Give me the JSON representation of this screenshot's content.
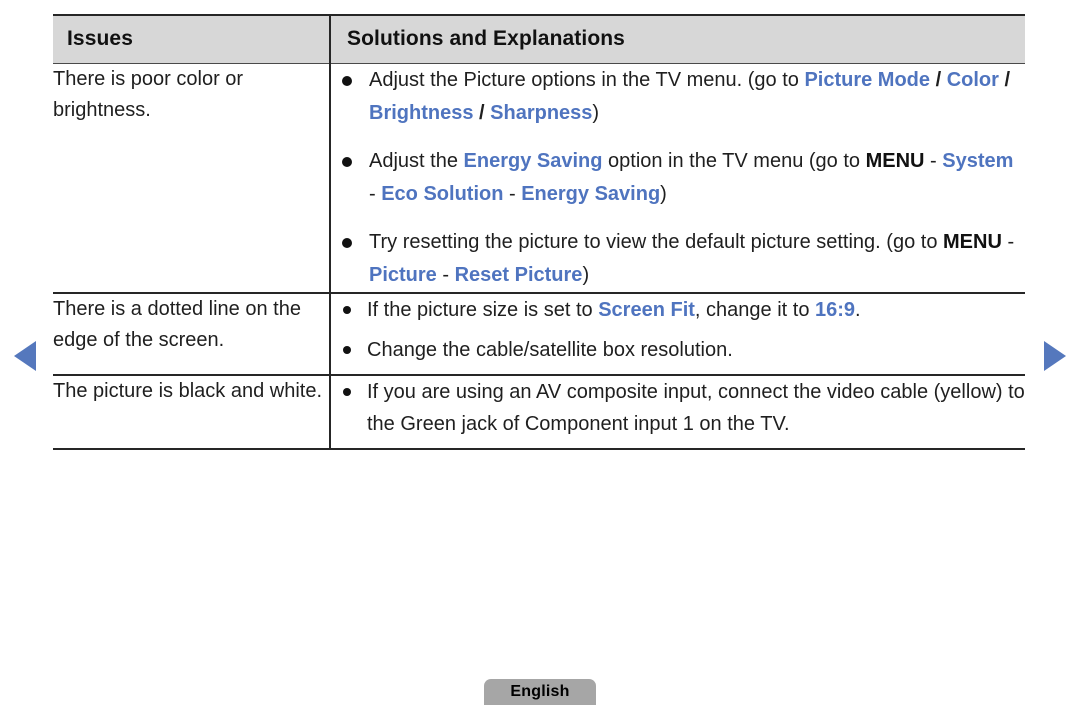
{
  "nav": {
    "prev_icon": "triangle-left-icon",
    "next_icon": "triangle-right-icon",
    "arrow_color": "#5578bd"
  },
  "table": {
    "headers": {
      "issues": "Issues",
      "solutions": "Solutions and Explanations"
    },
    "rows": [
      {
        "issue": "There is poor color or brightness.",
        "bullets": [
          {
            "segments": [
              {
                "text": "Adjust the Picture options in the TV menu. (go to ",
                "style": "plain"
              },
              {
                "text": "Picture Mode",
                "style": "menu"
              },
              {
                "text": " / ",
                "style": "sep"
              },
              {
                "text": "Color",
                "style": "menu"
              },
              {
                "text": " / ",
                "style": "sep"
              },
              {
                "text": "Brightness",
                "style": "menu"
              },
              {
                "text": " / ",
                "style": "sep"
              },
              {
                "text": "Sharpness",
                "style": "menu"
              },
              {
                "text": ")",
                "style": "plain"
              }
            ]
          },
          {
            "segments": [
              {
                "text": "Adjust the ",
                "style": "plain"
              },
              {
                "text": "Energy Saving",
                "style": "menu"
              },
              {
                "text": " option in the TV menu (go to ",
                "style": "plain"
              },
              {
                "text": "MENU",
                "style": "key"
              },
              {
                "text": " - ",
                "style": "plain"
              },
              {
                "text": "System",
                "style": "menu"
              },
              {
                "text": " - ",
                "style": "plain"
              },
              {
                "text": "Eco Solution",
                "style": "menu"
              },
              {
                "text": " - ",
                "style": "plain"
              },
              {
                "text": "Energy Saving",
                "style": "menu"
              },
              {
                "text": ")",
                "style": "plain"
              }
            ]
          },
          {
            "segments": [
              {
                "text": "Try resetting the picture to view the default picture setting. (go to ",
                "style": "plain"
              },
              {
                "text": "MENU",
                "style": "key"
              },
              {
                "text": " - ",
                "style": "plain"
              },
              {
                "text": "Picture",
                "style": "menu"
              },
              {
                "text": " - ",
                "style": "plain"
              },
              {
                "text": "Reset Picture",
                "style": "menu"
              },
              {
                "text": ")",
                "style": "plain"
              }
            ]
          }
        ]
      },
      {
        "issue": "There is a dotted line on the edge of the screen.",
        "bullets": [
          {
            "segments": [
              {
                "text": "If the picture size is set to ",
                "style": "plain"
              },
              {
                "text": "Screen Fit",
                "style": "menu"
              },
              {
                "text": ", change it to ",
                "style": "plain"
              },
              {
                "text": "16:9",
                "style": "menu"
              },
              {
                "text": ".",
                "style": "plain"
              }
            ]
          },
          {
            "segments": [
              {
                "text": "Change the cable/satellite box resolution.",
                "style": "plain"
              }
            ]
          }
        ]
      },
      {
        "issue": "The picture is black and white.",
        "bullets": [
          {
            "segments": [
              {
                "text": "If you are using an AV composite input, connect the video cable (yellow) to the Green jack of Component input 1 on the TV.",
                "style": "plain"
              }
            ]
          }
        ]
      }
    ]
  },
  "footer": {
    "language_label": "English"
  },
  "colors": {
    "menu_blue": "#4f74bf",
    "header_bg": "#d7d7d7",
    "badge_bg": "#a6a6a6",
    "rule": "#262626"
  }
}
